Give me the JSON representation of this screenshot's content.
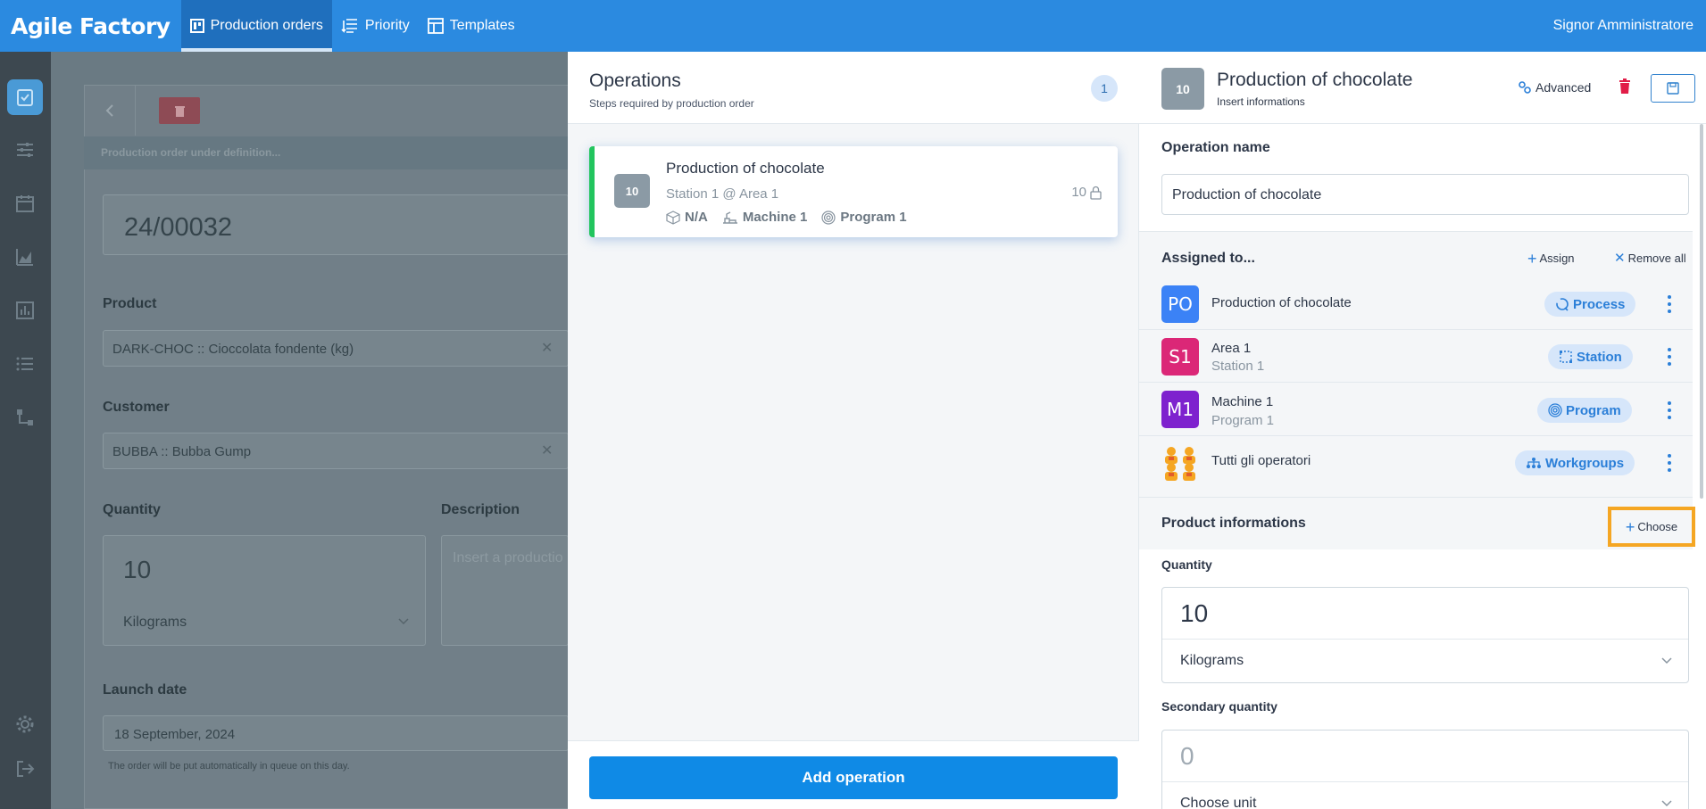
{
  "app": {
    "brand": "Agile Factory",
    "user": "Signor Amministratore"
  },
  "nav": [
    {
      "label": "Production orders",
      "icon": "board-icon",
      "active": true
    },
    {
      "label": "Priority",
      "icon": "priority-icon",
      "active": false
    },
    {
      "label": "Templates",
      "icon": "template-icon",
      "active": false
    }
  ],
  "background": {
    "status": "Production order under definition...",
    "order_code": "24/00032",
    "product_label": "Product",
    "product_value": "DARK-CHOC :: Cioccolata fondente (kg)",
    "customer_label": "Customer",
    "customer_value": "BUBBA :: Bubba Gump",
    "quantity_label": "Quantity",
    "quantity_value": "10",
    "quantity_unit": "Kilograms",
    "description_label": "Description",
    "description_placeholder": "Insert a productio",
    "launch_label": "Launch date",
    "launch_value": "18 September, 2024",
    "launch_hint": "The order will be put automatically in queue on this day."
  },
  "operations": {
    "title": "Operations",
    "subtitle": "Steps required by production order",
    "count": "1",
    "items": [
      {
        "number": "10",
        "title": "Production of chocolate",
        "location": "Station 1 @ Area 1",
        "product": "N/A",
        "machine": "Machine 1",
        "program": "Program 1",
        "quantity": "10"
      }
    ],
    "add_label": "Add operation"
  },
  "detail": {
    "number": "10",
    "title": "Production of chocolate",
    "subtitle": "Insert informations",
    "advanced_label": "Advanced",
    "op_name_label": "Operation name",
    "op_name_value": "Production of chocolate",
    "assigned_label": "Assigned to...",
    "assign_label": "Assign",
    "remove_all_label": "Remove all",
    "assignments": [
      {
        "initials": "PO",
        "color": "#3b82f6",
        "name": "Production of chocolate",
        "sub": "",
        "pill": "Process",
        "pill_icon": "process-icon"
      },
      {
        "initials": "S1",
        "color": "#db2777",
        "name": "Area 1",
        "sub": "Station 1",
        "pill": "Station",
        "pill_icon": "station-icon"
      },
      {
        "initials": "M1",
        "color": "#7e22ce",
        "name": "Machine 1",
        "sub": "Program 1",
        "pill": "Program",
        "pill_icon": "program-icon"
      },
      {
        "initials": "",
        "color": "#f5a623",
        "name": "Tutti gli operatori",
        "sub": "",
        "pill": "Workgroups",
        "pill_icon": "workgroups-icon"
      }
    ],
    "product_info_label": "Product informations",
    "choose_label": "Choose",
    "quantity_label": "Quantity",
    "quantity_value": "10",
    "quantity_unit": "Kilograms",
    "secondary_label": "Secondary quantity",
    "secondary_value": "0",
    "secondary_unit": "Choose unit"
  },
  "colors": {
    "primary": "#2b8ae0",
    "accent_green": "#22c55e",
    "highlight": "#f5a623",
    "danger": "#e11d48"
  }
}
